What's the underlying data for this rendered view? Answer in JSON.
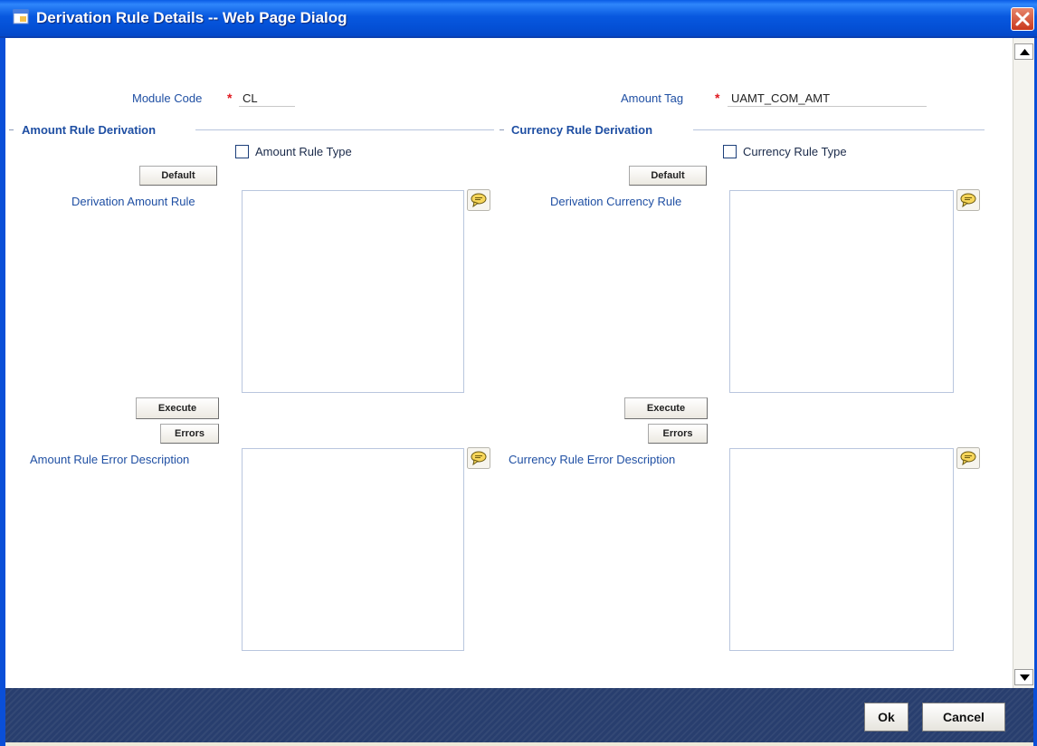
{
  "window": {
    "title": "Derivation Rule Details -- Web Page Dialog",
    "icon": "ie-page-icon"
  },
  "header": {
    "module_code_label": "Module Code",
    "module_code_value": "CL",
    "amount_tag_label": "Amount Tag",
    "amount_tag_value": "UAMT_COM_AMT",
    "required_marker": "*"
  },
  "amount_section": {
    "title": "Amount Rule Derivation",
    "rule_type_label": "Amount Rule Type",
    "rule_type_checked": false,
    "default_button": "Default",
    "rule_label": "Derivation Amount Rule",
    "execute_button": "Execute",
    "errors_button": "Errors",
    "error_desc_label": "Amount Rule Error Description"
  },
  "currency_section": {
    "title": "Currency Rule Derivation",
    "rule_type_label": "Currency Rule Type",
    "rule_type_checked": false,
    "default_button": "Default",
    "rule_label": "Derivation Currency Rule",
    "execute_button": "Execute",
    "errors_button": "Errors",
    "error_desc_label": "Currency Rule Error Description"
  },
  "footer": {
    "ok_button": "Ok",
    "cancel_button": "Cancel"
  },
  "colors": {
    "title_bar": "#0858df",
    "label_blue": "#1f4fa3",
    "required_red": "#e0181f",
    "footer_bg": "#283e6e"
  }
}
